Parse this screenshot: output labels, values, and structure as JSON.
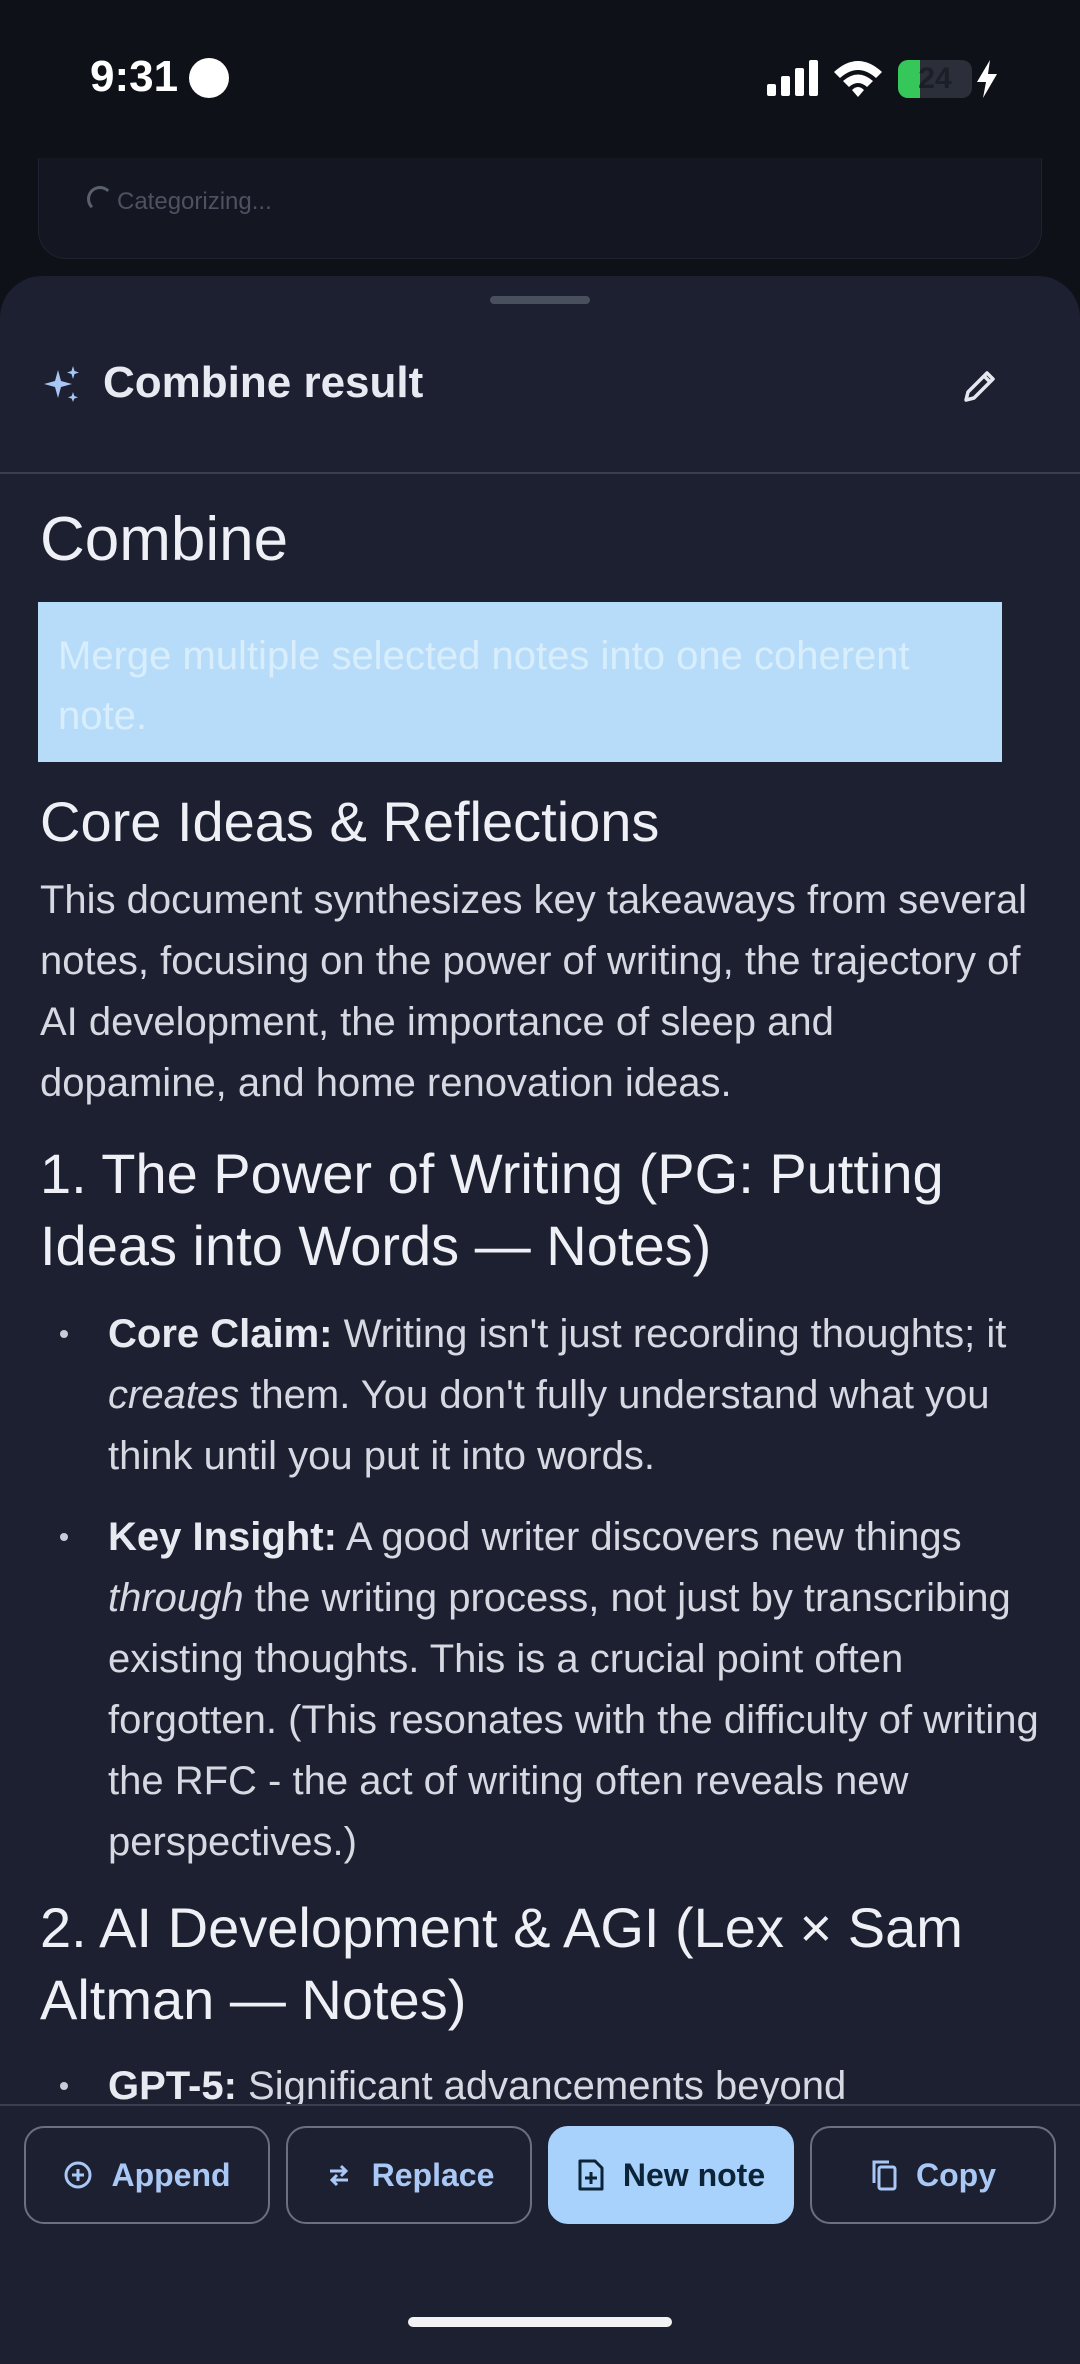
{
  "status_bar": {
    "time": "9:31",
    "battery_level": "24"
  },
  "background_card": {
    "status_text": "Categorizing..."
  },
  "sheet": {
    "title": "Combine result"
  },
  "document": {
    "title": "Combine",
    "description": "Merge multiple selected notes into one coherent note.",
    "heading": "Core Ideas & Reflections",
    "intro": "This document synthesizes key takeaways from several notes, focusing on the power of writing, the trajectory of AI development, the importance of sleep and dopamine, and home renovation ideas.",
    "section1": {
      "heading": "1. The Power of Writing (PG: Putting Ideas into Words — Notes)",
      "bullets": [
        {
          "label": "Core Claim:",
          "text_a": " Writing isn't just recording thoughts; it ",
          "emphasis": "creates",
          "text_b": " them.  You don't fully understand what you think until you put it into words."
        },
        {
          "label": "Key Insight:",
          "text_a": "  A good writer discovers new things ",
          "emphasis": "through",
          "text_b": " the writing process, not just by transcribing existing thoughts. This is a crucial point often forgotten.  (This resonates with the difficulty of writing the RFC - the act of writing often reveals new perspectives.)"
        }
      ]
    },
    "section2": {
      "heading": "2. AI Development & AGI (Lex × Sam Altman — Notes)",
      "bullets": [
        {
          "label": "GPT-5:",
          "text": "  Significant advancements beyond"
        }
      ]
    }
  },
  "actions": {
    "append": "Append",
    "replace": "Replace",
    "new_note": "New note",
    "copy": "Copy"
  },
  "colors": {
    "background": "#1d2030",
    "accent": "#a8d1fb",
    "highlight_box": "#b7dcfa"
  }
}
